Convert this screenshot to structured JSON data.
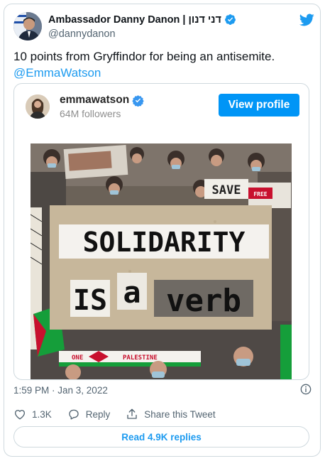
{
  "author": {
    "name": "Ambassador Danny Danon | דני דנון",
    "handle": "@dannydanon"
  },
  "tweet": {
    "text": "10 points from Gryffindor for being an antisemite.",
    "mention": "@EmmaWatson",
    "timestamp": "1:59 PM · Jan 3, 2022"
  },
  "embed": {
    "username": "emmawatson",
    "followers": "64M followers",
    "view_profile_label": "View profile",
    "image_text": {
      "line1": "SOLIDARITY",
      "line2_a": "IS",
      "line2_b": "a",
      "line2_c": "verb",
      "sign_save": "SAVE",
      "sign_free": "FREE",
      "sign_palestine": "PALESTINE",
      "sign_one": "ONE"
    }
  },
  "actions": {
    "likes": "1.3K",
    "reply_label": "Reply",
    "share_label": "Share this Tweet"
  },
  "read_replies_label": "Read 4.9K replies",
  "colors": {
    "twitter_blue": "#1d9bf0",
    "instagram_blue": "#0095f6",
    "text_secondary": "#536471",
    "border": "#cfd9de"
  },
  "icons": [
    "verified-badge-icon",
    "twitter-bird-icon",
    "info-icon",
    "heart-icon",
    "reply-icon",
    "share-icon"
  ]
}
